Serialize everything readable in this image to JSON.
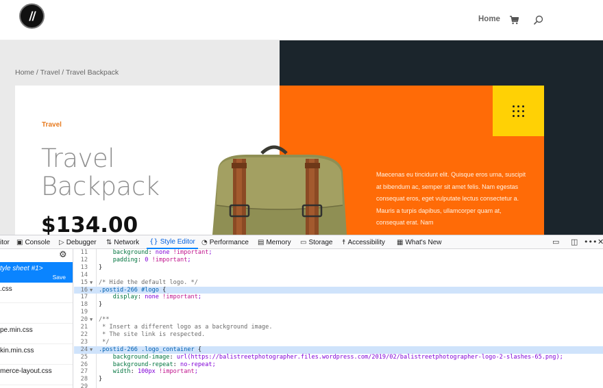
{
  "header": {
    "logo_text": "//",
    "nav": [
      {
        "label": "Home"
      }
    ],
    "cart_icon": "cart-icon",
    "search_icon": "search-icon"
  },
  "breadcrumb": {
    "items": [
      "Home",
      "Travel",
      "Travel Backpack"
    ],
    "separator": " / "
  },
  "product": {
    "category": "Travel",
    "title_line1": "Travel",
    "title_line2": "Backpack",
    "price": "$134.00",
    "description": "Maecenas eu tincidunt elit. Quisque eros urna, suscipit at bibendum ac, semper sit amet felis. Nam egestas consequat eros, eget vulputate lectus consectetur a. Mauris a turpis dapibus, ullamcorper quam at, consequat erat. Nam"
  },
  "colors": {
    "accent_orange": "#ff6b07",
    "accent_yellow": "#ffd105",
    "dark_panel": "#1b252c",
    "category_text": "#e77a1e",
    "devtools_active": "#0a84ff",
    "highlight": "#cfe3fb"
  },
  "devtools": {
    "tabs": [
      {
        "label": "itor",
        "icon": "inspector-icon"
      },
      {
        "label": "Console",
        "icon": "console-icon"
      },
      {
        "label": "Debugger",
        "icon": "debugger-icon"
      },
      {
        "label": "Network",
        "icon": "network-icon"
      },
      {
        "label": "Style Editor",
        "icon": "braces-icon",
        "active": true
      },
      {
        "label": "Performance",
        "icon": "performance-icon"
      },
      {
        "label": "Memory",
        "icon": "memory-icon"
      },
      {
        "label": "Storage",
        "icon": "storage-icon"
      },
      {
        "label": "Accessibility",
        "icon": "accessibility-icon"
      },
      {
        "label": "What's New",
        "icon": "gift-icon"
      }
    ],
    "right_icons": [
      "responsive-icon",
      "dock-icon",
      "more-icon",
      "close-icon"
    ],
    "sidebar": {
      "settings_icon": "gear-icon",
      "selected": {
        "name": "tyle sheet #1>",
        "save_label": "Save"
      },
      "items": [
        ".css",
        "",
        "pe.min.css",
        "kin.min.css",
        "merce-layout.css"
      ]
    },
    "editor": {
      "lines": [
        {
          "n": "11",
          "text": "    background: none !important;"
        },
        {
          "n": "12",
          "text": "    padding: 0 !important;"
        },
        {
          "n": "13",
          "text": "}"
        },
        {
          "n": "14",
          "text": ""
        },
        {
          "n": "15",
          "text": "/* Hide the default logo. */",
          "fold": true
        },
        {
          "n": "16",
          "text": ".postid-266 #logo {",
          "fold": true,
          "highlight": true
        },
        {
          "n": "17",
          "text": "    display: none !important;"
        },
        {
          "n": "18",
          "text": "}"
        },
        {
          "n": "19",
          "text": ""
        },
        {
          "n": "20",
          "text": "/**",
          "fold": true
        },
        {
          "n": "21",
          "text": " * Insert a different logo as a background image."
        },
        {
          "n": "22",
          "text": " * The site link is respected."
        },
        {
          "n": "23",
          "text": " */"
        },
        {
          "n": "24",
          "text": ".postid-266 .logo_container {",
          "fold": true,
          "highlight": true
        },
        {
          "n": "25",
          "text": "    background-image: url(https://balistreetphotographer.files.wordpress.com/2019/02/balistreetphotographer-logo-2-slashes-65.png);"
        },
        {
          "n": "26",
          "text": "    background-repeat: no-repeat;"
        },
        {
          "n": "27",
          "text": "    width: 100px !important;"
        },
        {
          "n": "28",
          "text": "}"
        },
        {
          "n": "29",
          "text": ""
        }
      ]
    }
  }
}
